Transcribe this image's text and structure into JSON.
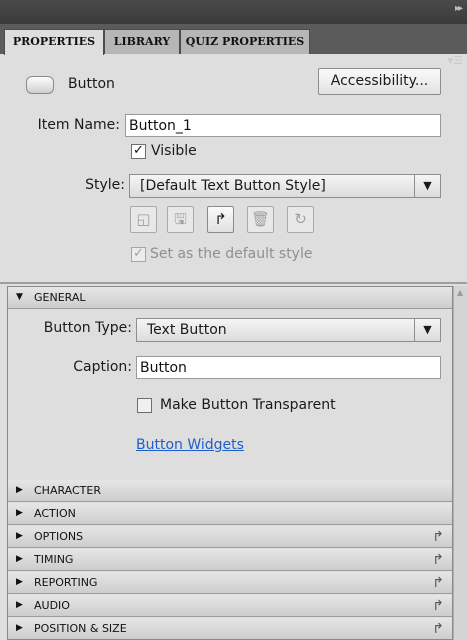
{
  "tabs": [
    {
      "label": "PROPERTIES",
      "active": true
    },
    {
      "label": "LIBRARY",
      "active": false
    },
    {
      "label": "QUIZ PROPERTIES",
      "active": false
    }
  ],
  "object": {
    "type_label": "Button",
    "icon": "button-shape-icon",
    "accessibility_label": "Accessibility..."
  },
  "item_name": {
    "label": "Item Name:",
    "value": "Button_1"
  },
  "visible": {
    "label": "Visible",
    "checked": true
  },
  "style": {
    "label": "Style:",
    "value": "[Default Text Button Style]",
    "buttons": [
      "new-style-icon",
      "save-style-icon",
      "reset-style-icon",
      "delete-style-icon",
      "refresh-style-icon"
    ],
    "default_label": "Set as the default style",
    "default_checked": true
  },
  "general": {
    "title": "GENERAL",
    "button_type_label": "Button Type:",
    "button_type_value": "Text Button",
    "caption_label": "Caption:",
    "caption_value": "Button",
    "transparent_label": "Make Button Transparent",
    "transparent_checked": false,
    "widgets_link": "Button Widgets"
  },
  "sections": [
    {
      "title": "CHARACTER",
      "reset": false
    },
    {
      "title": "ACTION",
      "reset": false
    },
    {
      "title": "OPTIONS",
      "reset": true
    },
    {
      "title": "TIMING",
      "reset": true
    },
    {
      "title": "REPORTING",
      "reset": true
    },
    {
      "title": "AUDIO",
      "reset": true
    },
    {
      "title": "POSITION & SIZE",
      "reset": true
    }
  ],
  "colors": {
    "link": "#1f5ec9",
    "header": "#3a3a3a",
    "panel": "#dedede"
  }
}
